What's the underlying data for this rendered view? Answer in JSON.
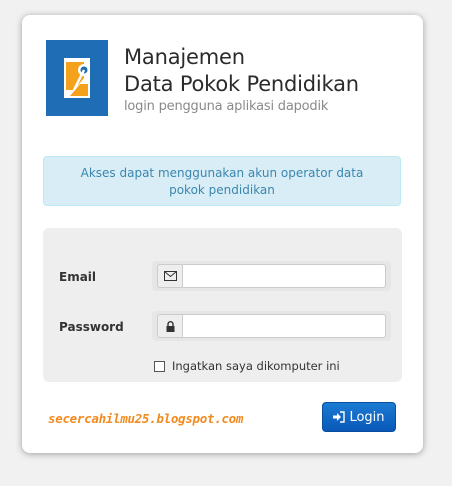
{
  "brand": {
    "title_line1": "Manajemen",
    "title_line2": "Data Pokok Pendidikan",
    "subtitle": "login pengguna aplikasi dapodik",
    "logo_icon": "dapodik-logo",
    "colors": {
      "blue": "#1f6db5",
      "orange": "#f4a21c"
    }
  },
  "alert": {
    "message": "Akses dapat menggunakan akun operator data pokok pendidikan",
    "color": "#d9edf7"
  },
  "form": {
    "email_label": "Email",
    "email_value": "",
    "email_icon": "envelope-icon",
    "password_label": "Password",
    "password_value": "",
    "password_icon": "lock-icon",
    "remember_label": "Ingatkan saya dikomputer ini",
    "remember_checked": false
  },
  "footer": {
    "blog_text": "secercahilmu25.blogspot.com",
    "login_label": "Login",
    "login_icon": "sign-in-icon",
    "accent": "#0d61c2"
  }
}
